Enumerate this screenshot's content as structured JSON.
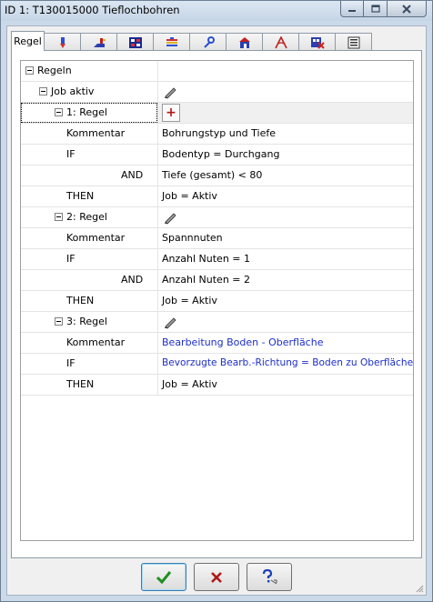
{
  "window": {
    "title": "ID 1: T130015000 Tieflochbohren"
  },
  "tabs": [
    {
      "label": "Regel",
      "icon": "rule-tab",
      "active": true
    },
    {
      "icon": "tool-tab"
    },
    {
      "icon": "machine-tab"
    },
    {
      "icon": "table-tab"
    },
    {
      "icon": "layers-tab"
    },
    {
      "icon": "wrench-tab"
    },
    {
      "icon": "house-tab"
    },
    {
      "icon": "angle-tab"
    },
    {
      "icon": "delete-tab"
    },
    {
      "icon": "list-tab"
    }
  ],
  "tree": {
    "root": "Regeln",
    "job": "Job aktiv",
    "rule1": {
      "label": "1: Regel",
      "add_symbol": "+",
      "kommentar_label": "Kommentar",
      "kommentar_value": "Bohrungstyp und Tiefe",
      "if_label": "IF",
      "if_value": "Bodentyp = Durchgang",
      "and_label": "AND",
      "and_value": "Tiefe (gesamt) < 80",
      "then_label": "THEN",
      "then_value": "Job = Aktiv"
    },
    "rule2": {
      "label": "2: Regel",
      "kommentar_label": "Kommentar",
      "kommentar_value": "Spannnuten",
      "if_label": "IF",
      "if_value": "Anzahl Nuten = 1",
      "and_label": "AND",
      "and_value": "Anzahl Nuten = 2",
      "then_label": "THEN",
      "then_value": "Job = Aktiv"
    },
    "rule3": {
      "label": "3: Regel",
      "kommentar_label": "Kommentar",
      "kommentar_value": "Bearbeitung Boden - Oberfläche",
      "if_label": "IF",
      "if_value": "Bevorzugte Bearb.-Richtung = Boden zu Oberfläche",
      "then_label": "THEN",
      "then_value": "Job = Aktiv"
    }
  },
  "buttons": {
    "ok_icon": "checkmark-icon",
    "cancel_icon": "x-icon",
    "help_icon": "help-icon"
  },
  "colors": {
    "link_text": "#1c2ec9",
    "ok_green": "#1f8f1f",
    "cancel_red": "#b01818",
    "add_red": "#b01818"
  }
}
